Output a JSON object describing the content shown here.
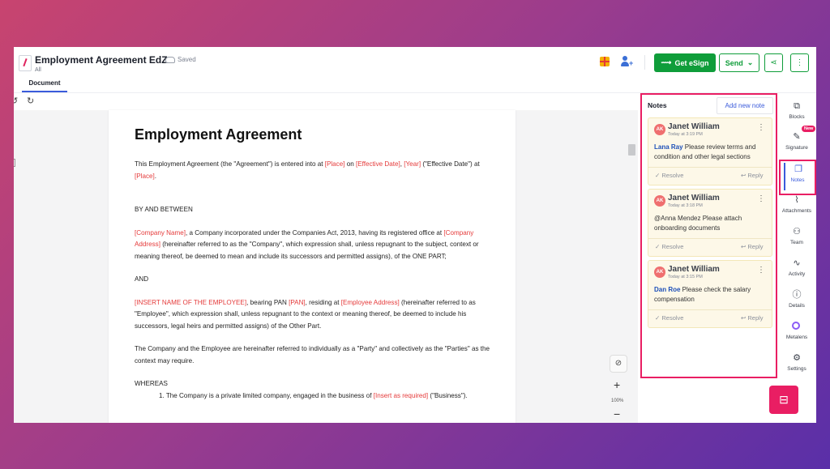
{
  "header": {
    "title": "Employment Agreement EdZ",
    "subtitle": "All",
    "saved_status": "Saved",
    "esign_label": "Get eSign",
    "send_label": "Send"
  },
  "tabs": [
    {
      "label": "Document",
      "active": true
    }
  ],
  "document": {
    "heading": "Employment Agreement",
    "intro": {
      "a": "This Employment Agreement (the \"Agreement\") is entered into at ",
      "place": "[Place]",
      "b": " on ",
      "effective_date": "[Effective Date]",
      "c": ", ",
      "year": "[Year]",
      "d": " (\"Effective Date\") at ",
      "place2": "[Place]",
      "e": "."
    },
    "between": "BY AND BETWEEN",
    "company": {
      "name": "[Company Name]",
      "a": ", a Company incorporated under the Companies Act, 2013, having its registered office at ",
      "address": "[Company Address]",
      "b": " (hereinafter referred to as the \"Company\", which expression shall, unless repugnant to the subject, context or meaning thereof, be deemed to mean and include its successors and permitted assigns), of the ONE PART;"
    },
    "and": "AND",
    "employee": {
      "name": "[INSERT NAME OF THE EMPLOYEE]",
      "a": ", bearing PAN ",
      "pan": "[PAN]",
      "b": ", residing at ",
      "address": "[Employee Address]",
      "c": " (hereinafter referred to as \"Employee\", which expression shall, unless repugnant to the context or meaning thereof, be deemed to include his successors, legal heirs and permitted assigns) of the Other Part."
    },
    "parties": "The Company and the Employee are hereinafter referred to individually as a \"Party\" and collectively as the \"Parties\" as the context may require.",
    "whereas": "WHEREAS",
    "item1": {
      "a": "1. The Company is a private limited company, engaged in the business of ",
      "insert": "[Insert as required]",
      "b": " (\"Business\")."
    }
  },
  "zoom": {
    "level": "100%"
  },
  "notes": {
    "title": "Notes",
    "add_label": "Add new note",
    "items": [
      {
        "initials": "AK",
        "author": "Janet William",
        "time": "Today at 3:19 PM",
        "mention": "Lana Ray",
        "text": " Please review terms and condition and other legal sections",
        "resolve": "Resolve",
        "reply": "Reply"
      },
      {
        "initials": "AK",
        "author": "Janet William",
        "time": "Today at 3:18 PM",
        "mention": "",
        "text": "@Anna Mendez Please attach onboarding documents",
        "resolve": "Resolve",
        "reply": "Reply"
      },
      {
        "initials": "AK",
        "author": "Janet William",
        "time": "Today at 3:15 PM",
        "mention": "Dan Roe",
        "text": " Please check the salary compensation",
        "resolve": "Resolve",
        "reply": "Reply"
      }
    ]
  },
  "rail": {
    "blocks": "Blocks",
    "signature": "Signature",
    "new_badge": "New",
    "notes": "Notes",
    "attachments": "Attachments",
    "team": "Team",
    "activity": "Activity",
    "details": "Details",
    "metalens": "Metalens",
    "settings": "Settings"
  },
  "colors": {
    "accent": "#e91e63",
    "primary": "#0f9d3a",
    "link": "#3b5bdb",
    "placeholder": "#e53a3a"
  },
  "icons": [
    "document-icon",
    "cloud-saved-icon",
    "gift-icon",
    "add-user-icon",
    "signature-icon",
    "share-icon",
    "more-vertical-icon",
    "undo-icon",
    "redo-icon",
    "blocks-icon",
    "signature-rail-icon",
    "notes-icon",
    "paperclip-icon",
    "team-icon",
    "activity-icon",
    "info-icon",
    "metalens-icon",
    "gear-icon",
    "chat-icon"
  ]
}
